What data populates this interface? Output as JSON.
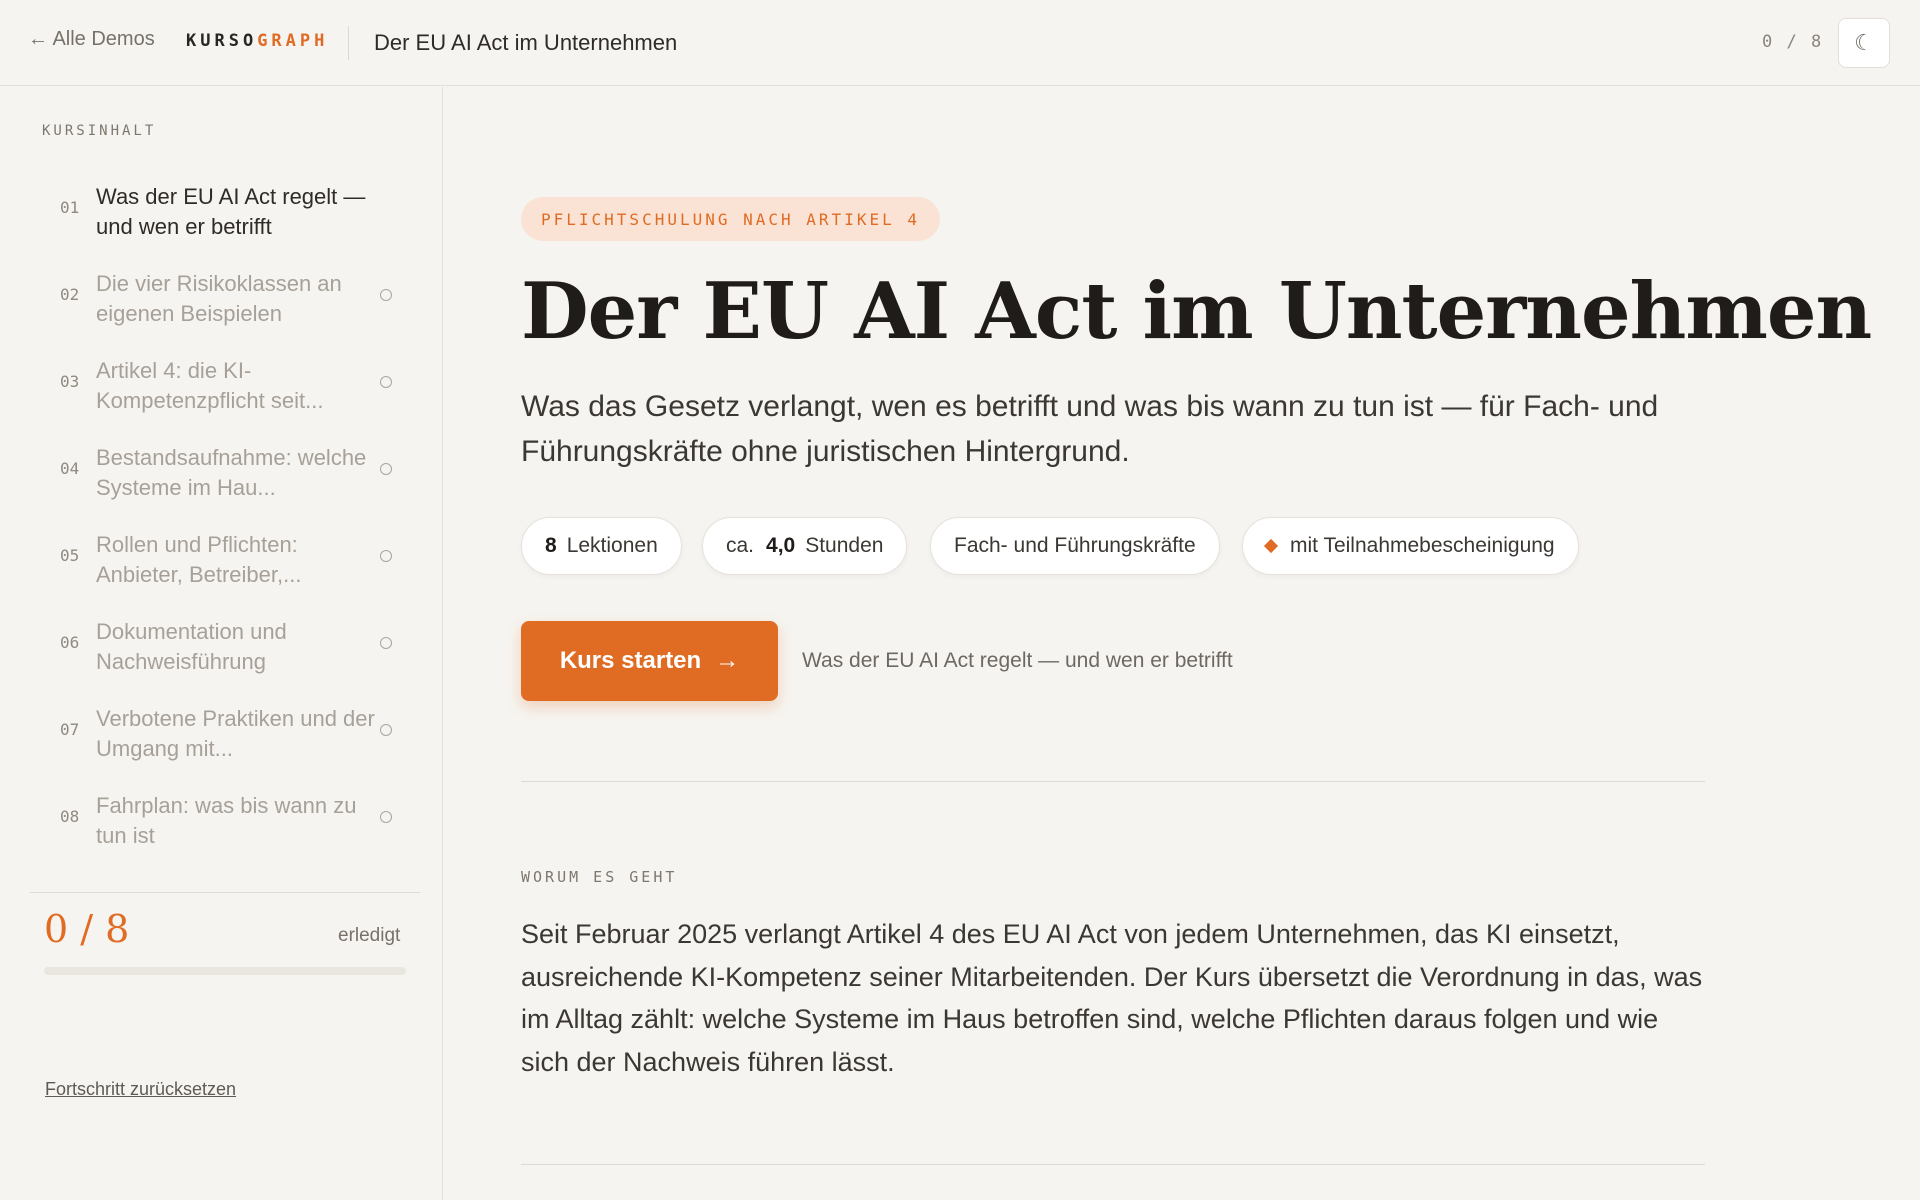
{
  "header": {
    "back_label": "← Alle Demos",
    "brand_part1": "KURSO",
    "brand_part2": "GRAPH",
    "course_title": "Der EU AI Act im Unternehmen",
    "progress": "0 / 8",
    "theme_toggle": "☾"
  },
  "sidebar": {
    "heading": "KURSINHALT",
    "lessons": [
      {
        "num": "01",
        "label": "Was der EU AI Act regelt — und wen er betrifft"
      },
      {
        "num": "02",
        "label": "Die vier Risikoklassen an eigenen Beispielen"
      },
      {
        "num": "03",
        "label": "Artikel 4: die KI-Kompetenzpflicht seit..."
      },
      {
        "num": "04",
        "label": "Bestandsaufnahme: welche Systeme im Hau..."
      },
      {
        "num": "05",
        "label": "Rollen und Pflichten: Anbieter, Betreiber,..."
      },
      {
        "num": "06",
        "label": "Dokumentation und Nachweisführung"
      },
      {
        "num": "07",
        "label": "Verbotene Praktiken und der Umgang mit..."
      },
      {
        "num": "08",
        "label": "Fahrplan: was bis wann zu tun ist"
      }
    ],
    "done_count": "0 / 8",
    "done_label": "erledigt",
    "progress_fraction": 0,
    "reset_label": "Fortschritt zurücksetzen"
  },
  "main": {
    "badge": "PFLICHTSCHULUNG NACH ARTIKEL 4",
    "title": "Der EU AI Act im Unternehmen",
    "subtitle": "Was das Gesetz verlangt, wen es betrifft und was bis wann zu tun ist — für Fach- und Führungskräfte ohne juristischen Hintergrund.",
    "pills": {
      "lessons_value": "8",
      "lessons_label": "Lektionen",
      "hours_prefix": "ca.",
      "hours_value": "4,0",
      "hours_label": "Stunden",
      "audience": "Fach- und Führungskräfte",
      "certificate": "mit Teilnahmebescheinigung"
    },
    "start_label": "Kurs starten",
    "start_arrow": "→",
    "start_hint": "Was der EU AI Act regelt — und wen er betrifft",
    "section_label": "WORUM ES GEHT",
    "section_body": "Seit Februar 2025 verlangt Artikel 4 des EU AI Act von jedem Unternehmen, das KI einsetzt, ausreichende KI-Kompetenz seiner Mitarbeitenden. Der Kurs übersetzt die Verordnung in das, was im Alltag zählt: welche Systeme im Haus betroffen sind, welche Pflichten daraus folgen und wie sich der Nachweis führen lässt."
  },
  "colors": {
    "accent": "#e06b23",
    "background": "#f6f4f0",
    "badge_bg": "#fae3d4"
  }
}
